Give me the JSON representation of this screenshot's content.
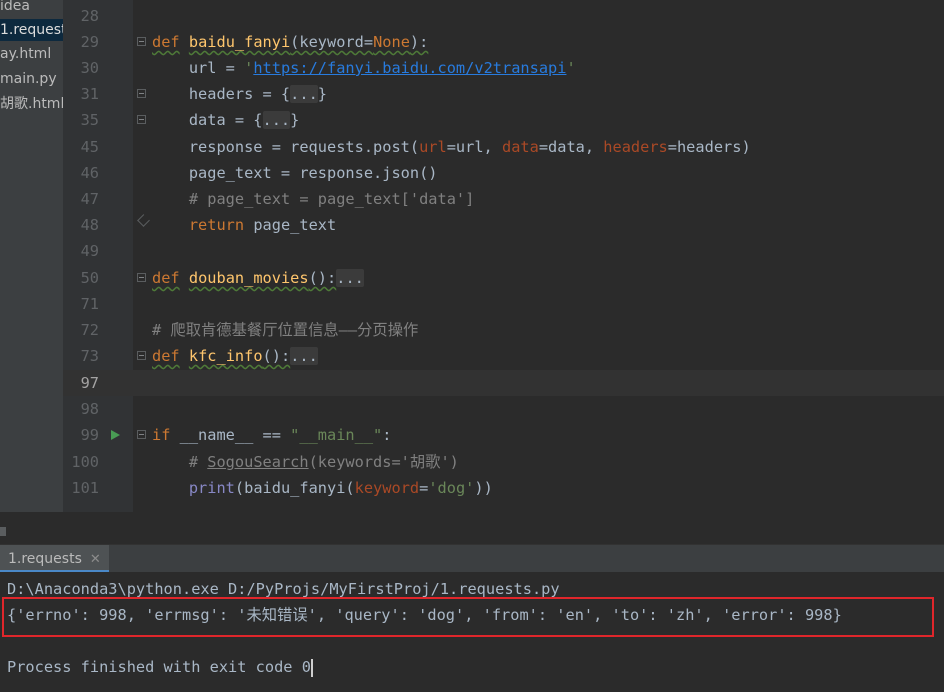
{
  "sidebar": {
    "files": [
      {
        "label": "idea",
        "selected": false
      },
      {
        "label": "1.request",
        "selected": true
      },
      {
        "label": "ay.html",
        "selected": false
      },
      {
        "label": "main.py",
        "selected": false
      },
      {
        "label": "胡歌.html",
        "selected": false
      }
    ]
  },
  "editor": {
    "lines": [
      {
        "num": "28",
        "text": ""
      },
      {
        "num": "29",
        "text": "def baidu_fanyi(keyword=None):"
      },
      {
        "num": "30",
        "text": "url = 'https://fanyi.baidu.com/v2transapi'"
      },
      {
        "num": "31",
        "text": "headers = {...}"
      },
      {
        "num": "35",
        "text": "data = {...}"
      },
      {
        "num": "45",
        "text": "response = requests.post(url=url, data=data, headers=headers)"
      },
      {
        "num": "46",
        "text": "page_text = response.json()"
      },
      {
        "num": "47",
        "text": "# page_text = page_text['data']"
      },
      {
        "num": "48",
        "text": "return page_text"
      },
      {
        "num": "49",
        "text": ""
      },
      {
        "num": "50",
        "text": "def douban_movies():..."
      },
      {
        "num": "71",
        "text": ""
      },
      {
        "num": "72",
        "text": "# 爬取肯德基餐厅位置信息——分页操作"
      },
      {
        "num": "73",
        "text": "def kfc_info():..."
      },
      {
        "num": "97",
        "text": ""
      },
      {
        "num": "98",
        "text": ""
      },
      {
        "num": "99",
        "text": "if __name__ == \"__main__\":"
      },
      {
        "num": "100",
        "text": "# SogouSearch(keywords='胡歌')"
      },
      {
        "num": "101",
        "text": "print(baidu_fanyi(keyword='dog'))"
      }
    ]
  },
  "run": {
    "tab_label": "1.requests",
    "close_label": "✕",
    "command": "D:\\Anaconda3\\python.exe D:/PyProjs/MyFirstProj/1.requests.py",
    "output": "{'errno': 998, 'errmsg': '未知错误', 'query': 'dog', 'from': 'en', 'to': 'zh', 'error': 998}",
    "exit": "Process finished with exit code 0"
  }
}
